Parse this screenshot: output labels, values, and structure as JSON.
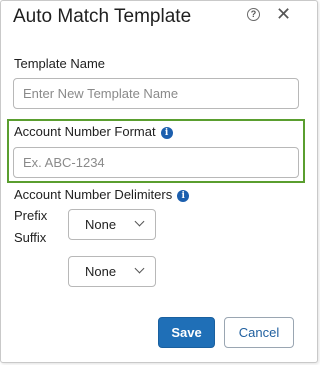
{
  "dialog": {
    "title": "Auto Match Template",
    "help_icon": "question-circle-icon",
    "close_glyph": "✕"
  },
  "template_name": {
    "label": "Template Name",
    "placeholder": "Enter New Template Name",
    "value": ""
  },
  "account_number_format": {
    "label": "Account Number Format",
    "placeholder": "Ex. ABC-1234",
    "value": "",
    "info_glyph": "i",
    "highlight_color": "#5a9e2f"
  },
  "delimiters": {
    "label": "Account Number Delimiters",
    "info_glyph": "i",
    "prefix": {
      "label": "Prefix",
      "selected": "None"
    },
    "suffix": {
      "label": "Suffix",
      "selected": "None"
    }
  },
  "buttons": {
    "save_label": "Save",
    "cancel_label": "Cancel",
    "save_color": "#1f6fb7"
  }
}
